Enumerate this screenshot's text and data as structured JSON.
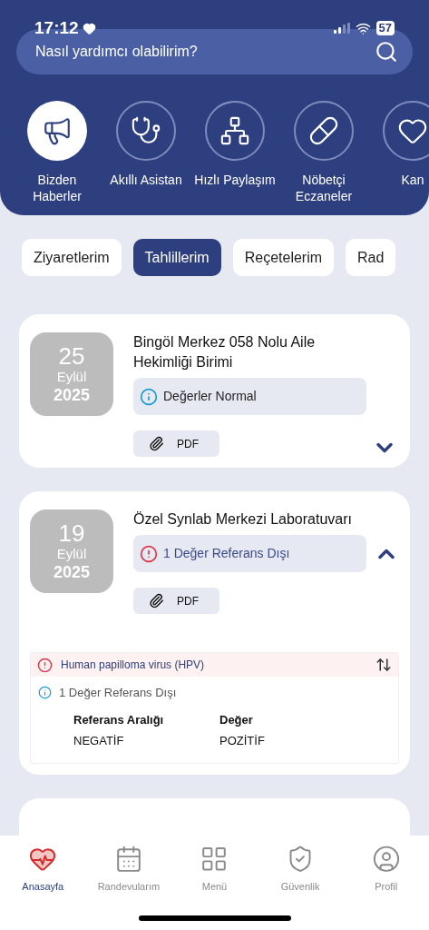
{
  "status_bar": {
    "time": "17:12",
    "battery": "57"
  },
  "search": {
    "placeholder": "Nasıl yardımcı olabilirim?"
  },
  "shortcuts": [
    {
      "label": "Bizden Haberler",
      "kind": "megaphone",
      "selected": true
    },
    {
      "label": "Akıllı Asistan",
      "kind": "doctor",
      "selected": false
    },
    {
      "label": "Hızlı Paylaşım",
      "kind": "network",
      "selected": false
    },
    {
      "label": "Nöbetçi Eczaneler",
      "kind": "pill",
      "selected": false
    },
    {
      "label": "Kan",
      "kind": "heart",
      "selected": false
    }
  ],
  "tabs": [
    {
      "label": "Ziyaretlerim",
      "selected": false
    },
    {
      "label": "Tahlillerim",
      "selected": true
    },
    {
      "label": "Reçetelerim",
      "selected": false
    },
    {
      "label": "Rad",
      "selected": false
    }
  ],
  "results": [
    {
      "day": "25",
      "month": "Eylül",
      "year": "2025",
      "title": "Bingöl Merkez 058 Nolu Aile Hekimliği Birimi",
      "status": {
        "kind": "normal",
        "text": "Değerler Normal"
      },
      "pdf": "PDF",
      "expanded": false
    },
    {
      "day": "19",
      "month": "Eylül",
      "year": "2025",
      "title": "Özel Synlab Merkezi Laboratuvarı",
      "status": {
        "kind": "warning",
        "text": "1 Değer Referans Dışı"
      },
      "pdf": "PDF",
      "expanded": true,
      "details": [
        {
          "test": "Human papilloma virus (HPV)",
          "note": "1 Değer Referans Dışı",
          "columns": [
            "Referans Aralığı",
            "Değer"
          ],
          "values": [
            "NEGATİF",
            "POZİTİF"
          ]
        }
      ]
    }
  ],
  "nav": [
    {
      "label": "Anasayfa",
      "kind": "home",
      "selected": true
    },
    {
      "label": "Randevularım",
      "kind": "calendar",
      "selected": false
    },
    {
      "label": "Menü",
      "kind": "menu",
      "selected": false
    },
    {
      "label": "Güvenlik",
      "kind": "security",
      "selected": false
    },
    {
      "label": "Profil",
      "kind": "profile",
      "selected": false
    }
  ]
}
